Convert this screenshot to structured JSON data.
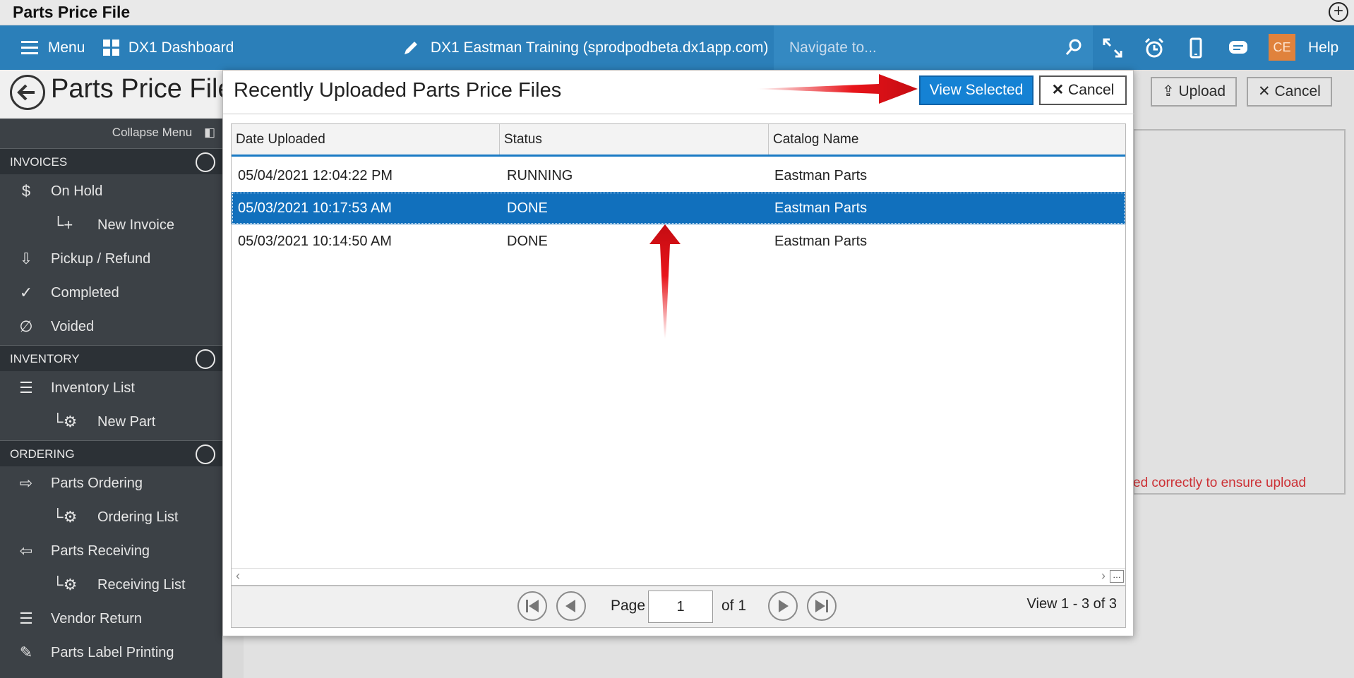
{
  "window": {
    "title": "Parts Price File"
  },
  "topbar": {
    "menu": "Menu",
    "dashboard": "DX1 Dashboard",
    "company": "DX1 Eastman Training (sprodpodbeta.dx1app.com)",
    "navigate_placeholder": "Navigate to...",
    "avatar": "CE",
    "help": "Help"
  },
  "page": {
    "title": "Parts Price File",
    "upload_label": "Upload",
    "cancel_label": "Cancel",
    "warning_text": "ed correctly to ensure upload"
  },
  "sidebar": {
    "collapse_label": "Collapse Menu",
    "sections": [
      {
        "title": "INVOICES",
        "items": [
          {
            "label": "On Hold",
            "icon": "dollar-icon"
          },
          {
            "label": "New Invoice",
            "icon": "plus-icon",
            "sub": true
          },
          {
            "label": "Pickup / Refund",
            "icon": "refund-icon"
          },
          {
            "label": "Completed",
            "icon": "check-icon"
          },
          {
            "label": "Voided",
            "icon": "void-icon"
          }
        ]
      },
      {
        "title": "INVENTORY",
        "items": [
          {
            "label": "Inventory List",
            "icon": "list-icon"
          },
          {
            "label": "New Part",
            "icon": "gear-icon",
            "sub": true
          }
        ]
      },
      {
        "title": "ORDERING",
        "items": [
          {
            "label": "Parts Ordering",
            "icon": "ordering-icon"
          },
          {
            "label": "Ordering List",
            "icon": "gear-icon",
            "sub": true
          },
          {
            "label": "Parts Receiving",
            "icon": "receiving-icon"
          },
          {
            "label": "Receiving List",
            "icon": "gear-icon",
            "sub": true
          },
          {
            "label": "Vendor Return",
            "icon": "list-icon"
          },
          {
            "label": "Parts Label Printing",
            "icon": "label-icon"
          }
        ]
      }
    ]
  },
  "modal": {
    "title": "Recently Uploaded Parts Price Files",
    "view_selected": "View Selected",
    "cancel": "Cancel",
    "columns": [
      "Date Uploaded",
      "Status",
      "Catalog Name"
    ],
    "rows": [
      {
        "date": "05/04/2021 12:04:22 PM",
        "status": "RUNNING",
        "catalog": "Eastman Parts",
        "selected": false
      },
      {
        "date": "05/03/2021 10:17:53 AM",
        "status": "DONE",
        "catalog": "Eastman Parts",
        "selected": true
      },
      {
        "date": "05/03/2021 10:14:50 AM",
        "status": "DONE",
        "catalog": "Eastman Parts",
        "selected": false
      }
    ],
    "pager": {
      "page_label": "Page",
      "page_value": "1",
      "of_label": "of 1",
      "view_count": "View 1 - 3 of 3"
    }
  },
  "colors": {
    "topbar": "#2b7fb9",
    "sidebar": "#3c4146",
    "selected_row": "#1170bd",
    "primary_button": "#1582d4",
    "annotation_arrow": "#e8141a",
    "avatar": "#e0823c"
  }
}
